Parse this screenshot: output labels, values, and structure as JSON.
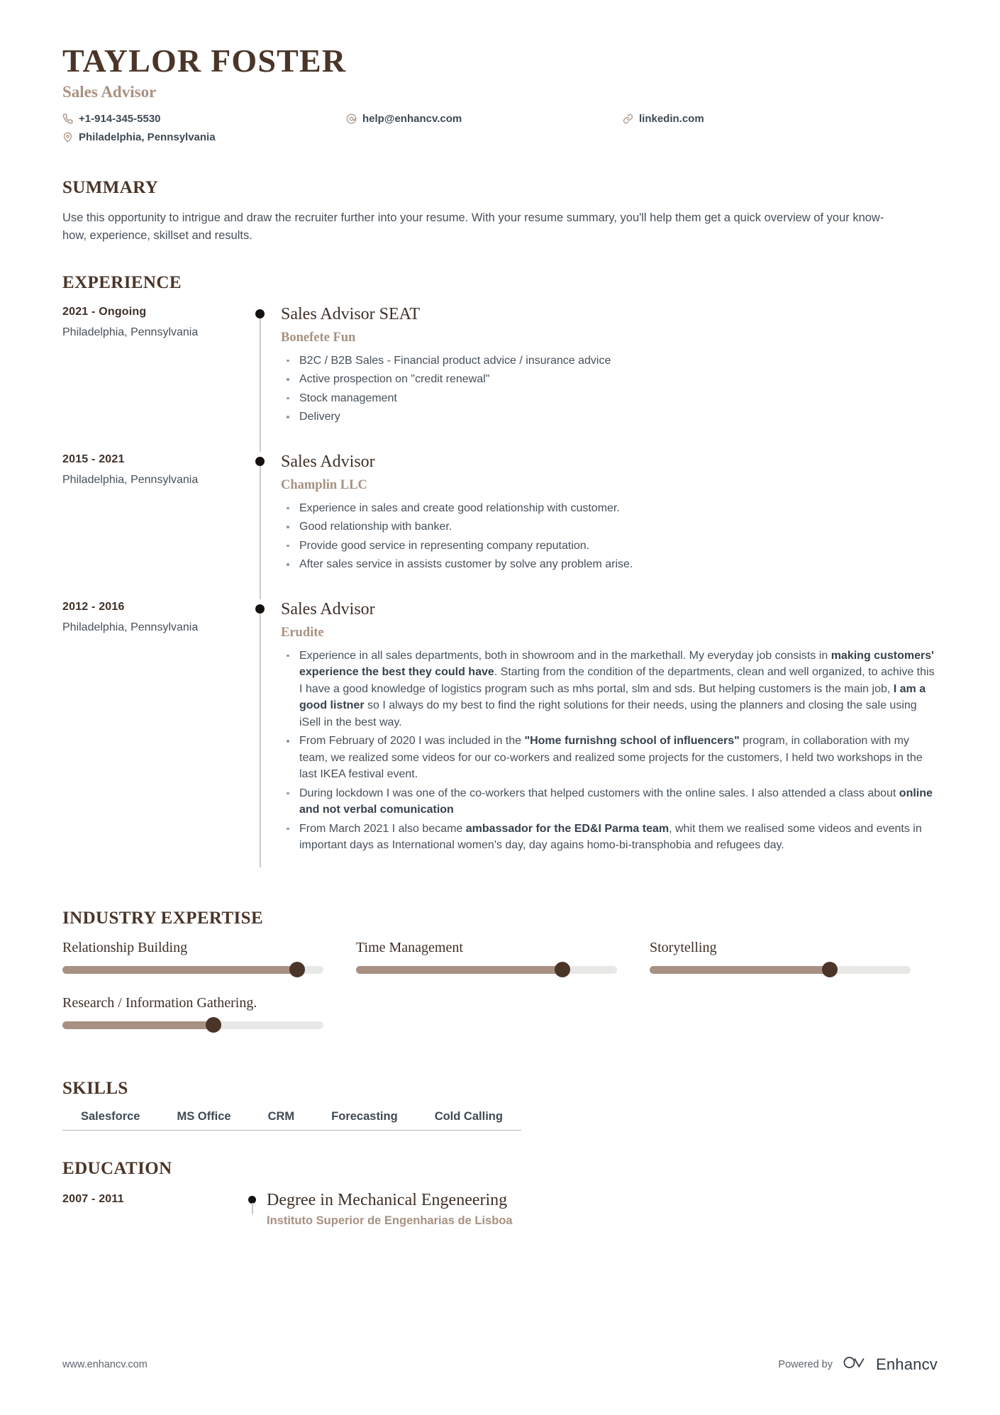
{
  "header": {
    "name": "TAYLOR FOSTER",
    "role": "Sales Advisor",
    "contacts": [
      {
        "icon": "phone-icon",
        "text": "+1-914-345-5530"
      },
      {
        "icon": "email-icon",
        "text": "help@enhancv.com"
      },
      {
        "icon": "link-icon",
        "text": "linkedin.com"
      },
      {
        "icon": "location-icon",
        "text": "Philadelphia, Pennsylvania"
      }
    ]
  },
  "summary": {
    "title": "SUMMARY",
    "text": "Use this opportunity to intrigue and draw the recruiter further into your resume. With your resume summary, you'll help them get a quick overview of your know-how, experience, skillset and results."
  },
  "experience": {
    "title": "EXPERIENCE",
    "items": [
      {
        "date": "2021 - Ongoing",
        "location": "Philadelphia, Pennsylvania",
        "title": "Sales Advisor SEAT",
        "company": "Bonefete Fun",
        "bullets": [
          "B2C / B2B Sales - Financial product advice / insurance advice",
          "Active prospection on \"credit renewal\"",
          "Stock management",
          "Delivery"
        ]
      },
      {
        "date": "2015 - 2021",
        "location": "Philadelphia, Pennsylvania",
        "title": "Sales Advisor",
        "company": "Champlin LLC",
        "bullets": [
          "Experience in sales and create good relationship with customer.",
          "Good relationship with banker.",
          "Provide good service in representing company reputation.",
          "After sales service in assists customer by solve any problem arise."
        ]
      },
      {
        "date": "2012 - 2016",
        "location": "Philadelphia, Pennsylvania",
        "title": "Sales Advisor",
        "company": "Erudite",
        "bullets_html": [
          "Experience in all sales departments, both in showroom and in the markethall. My everyday job consists in <b>making customers' experience the best they could have</b>. Starting from the condition of the departments, clean and well organized, to achive this I have a good knowledge of logistics program such as mhs portal, slm and sds. But helping customers is the main job, <b>I am a good listner</b> so I always do my best to find the right solutions for their needs, using the planners and closing the sale using iSell in the best way.",
          "From February of 2020 I was included in the <b>\"Home furnishng school of influencers\"</b> program, in collaboration with my team, we realized some videos for our co-workers and realized some projects for the customers, I held two workshops in the last IKEA festival event.",
          "During lockdown I was one of the co-workers that helped customers with the online sales. I also attended a class about <b>online and not verbal comunication</b>",
          "From March 2021 I also became <b>ambassador for the ED&I Parma team</b>, whit them we realised some videos and events in important days as International women's day, day agains homo-bi-transphobia and refugees day."
        ]
      }
    ]
  },
  "industry_expertise": {
    "title": "INDUSTRY EXPERTISE",
    "items": [
      {
        "label": "Relationship Building",
        "value": 90
      },
      {
        "label": "Time Management",
        "value": 79
      },
      {
        "label": "Storytelling",
        "value": 69
      },
      {
        "label": "Research / Information Gathering.",
        "value": 58
      }
    ]
  },
  "skills": {
    "title": "SKILLS",
    "items": [
      "Salesforce",
      "MS Office",
      "CRM",
      "Forecasting",
      "Cold Calling"
    ]
  },
  "education": {
    "title": "EDUCATION",
    "items": [
      {
        "date": "2007 - 2011",
        "degree": "Degree in Mechanical Engeneering",
        "school": "Instituto Superior de Engenharias de Lisboa"
      }
    ]
  },
  "footer": {
    "url": "www.enhancv.com",
    "powered_by": "Powered by",
    "brand": "Enhancv"
  },
  "colors": {
    "heading": "#4a3528",
    "accent": "#a89182",
    "body": "#46505a",
    "track": "#e8e8e6"
  }
}
